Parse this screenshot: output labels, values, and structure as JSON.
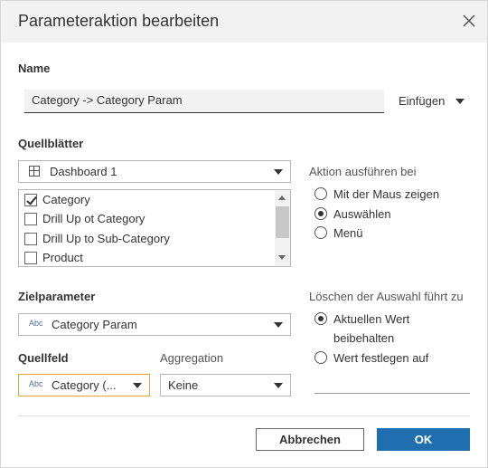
{
  "dialog": {
    "title": "Parameteraktion bearbeiten"
  },
  "name_section": {
    "label": "Name",
    "value": "Category -> Category Param",
    "insert_label": "Einfügen"
  },
  "source_sheets": {
    "label": "Quellblätter",
    "dashboard_select": "Dashboard 1",
    "items": [
      {
        "label": "Category",
        "checked": true
      },
      {
        "label": "Drill Up ot Category",
        "checked": false
      },
      {
        "label": "Drill Up to Sub-Category",
        "checked": false
      },
      {
        "label": "Product",
        "checked": false
      }
    ]
  },
  "run_action": {
    "label": "Aktion ausführen bei",
    "options": [
      {
        "label": "Mit der Maus zeigen",
        "selected": false
      },
      {
        "label": "Auswählen",
        "selected": true
      },
      {
        "label": "Menü",
        "selected": false
      }
    ]
  },
  "target": {
    "label": "Zielparameter",
    "type_badge": "Abc",
    "value": "Category Param"
  },
  "source_field": {
    "label": "Quellfeld",
    "type_badge": "Abc",
    "value": "Category (..."
  },
  "aggregation": {
    "label": "Aggregation",
    "value": "Keine"
  },
  "clear_selection": {
    "label": "Löschen der Auswahl führt zu",
    "option1_line1": "Aktuellen Wert",
    "option1_line2": "beibehalten",
    "option2": "Wert festlegen auf",
    "selected": 1
  },
  "buttons": {
    "cancel": "Abbrechen",
    "ok": "OK"
  },
  "colors": {
    "accent": "#1f6fb0",
    "focus_border": "#e8a23a",
    "titlebar": "#f2f2f2"
  }
}
